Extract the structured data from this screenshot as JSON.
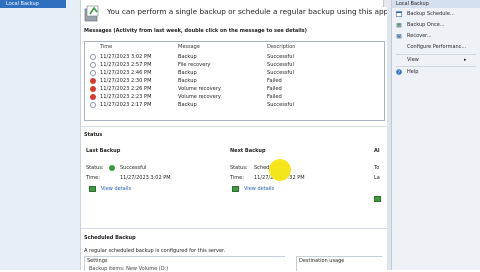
{
  "left_pane": {
    "item": "Local Backup"
  },
  "header": {
    "text": "You can perform a single backup or schedule a regular backup using this application."
  },
  "messages": {
    "title": "Messages (Activity from last week, double click on the message to see details)",
    "columns": [
      "Time",
      "Message",
      "Description"
    ],
    "rows": [
      {
        "type": "info",
        "time": "11/27/2023 3:02 PM",
        "message": "Backup",
        "description": "Successful"
      },
      {
        "type": "info",
        "time": "11/27/2023 2:57 PM",
        "message": "File recovery",
        "description": "Successful"
      },
      {
        "type": "info",
        "time": "11/27/2023 2:46 PM",
        "message": "Backup",
        "description": "Successful"
      },
      {
        "type": "error",
        "time": "11/27/2023 2:30 PM",
        "message": "Backup",
        "description": "Failed"
      },
      {
        "type": "error",
        "time": "11/27/2023 2:26 PM",
        "message": "Volume recovery",
        "description": "Failed"
      },
      {
        "type": "error",
        "time": "11/27/2023 2:23 PM",
        "message": "Volume recovery",
        "description": "Failed"
      },
      {
        "type": "info",
        "time": "11/27/2023 2:17 PM",
        "message": "Backup",
        "description": "Successful"
      }
    ]
  },
  "status": {
    "title": "Status",
    "last_backup": {
      "heading": "Last Backup",
      "status_label": "Status:",
      "status_value": "Successful",
      "time_label": "Time:",
      "time_value": "11/27/2023 3:02 PM",
      "link": "View details"
    },
    "next_backup": {
      "heading": "Next Backup",
      "status_label": "Status:",
      "status_value": "Scheduled",
      "time_label": "Time:",
      "time_value": "11/27/2023 3:32 PM",
      "link": "View details"
    },
    "third_col": {
      "heading": "Al",
      "line1": "To",
      "line2": "La"
    }
  },
  "scheduled": {
    "title": "Scheduled Backup",
    "text": "A regular scheduled backup is configured for this server.",
    "settings_label": "Settings",
    "settings_row": "Backup items:       New Volume (D:)",
    "destination_label": "Destination usage"
  },
  "actions": {
    "header": "Local Backup",
    "items": [
      {
        "label": "Backup Schedule...",
        "icon": "calendar-icon"
      },
      {
        "label": "Backup Once...",
        "icon": "backup-icon"
      },
      {
        "label": "Recover...",
        "icon": "recover-icon"
      },
      {
        "label": "Configure Performanc...",
        "icon": "blank"
      },
      {
        "label": "View",
        "icon": "blank",
        "arrow": "▸"
      },
      {
        "label": "Help",
        "icon": "help-icon"
      }
    ]
  },
  "colors": {
    "accent": "#2f6fc0",
    "error": "#d83b2b",
    "success": "#3a9a3a",
    "highlight": "#f5e61c"
  }
}
